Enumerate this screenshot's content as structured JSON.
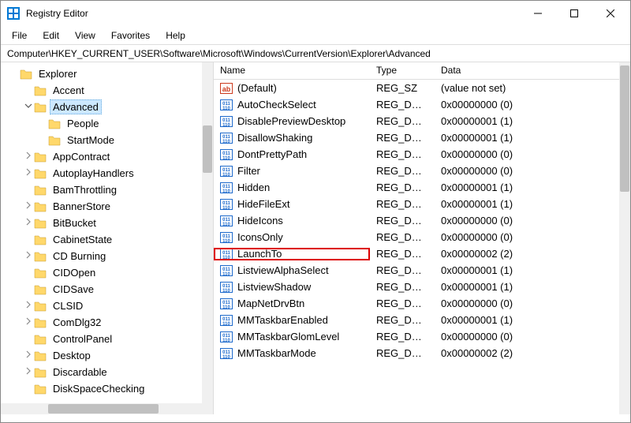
{
  "window": {
    "title": "Registry Editor"
  },
  "menu": {
    "file": "File",
    "edit": "Edit",
    "view": "View",
    "favorites": "Favorites",
    "help": "Help"
  },
  "address": "Computer\\HKEY_CURRENT_USER\\Software\\Microsoft\\Windows\\CurrentVersion\\Explorer\\Advanced",
  "tree": [
    {
      "label": "Explorer",
      "indent": 0,
      "twisty": ""
    },
    {
      "label": "Accent",
      "indent": 1,
      "twisty": ""
    },
    {
      "label": "Advanced",
      "indent": 1,
      "twisty": "v",
      "selected": true
    },
    {
      "label": "People",
      "indent": 2,
      "twisty": ""
    },
    {
      "label": "StartMode",
      "indent": 2,
      "twisty": ""
    },
    {
      "label": "AppContract",
      "indent": 1,
      "twisty": ">"
    },
    {
      "label": "AutoplayHandlers",
      "indent": 1,
      "twisty": ">"
    },
    {
      "label": "BamThrottling",
      "indent": 1,
      "twisty": ""
    },
    {
      "label": "BannerStore",
      "indent": 1,
      "twisty": ">"
    },
    {
      "label": "BitBucket",
      "indent": 1,
      "twisty": ">"
    },
    {
      "label": "CabinetState",
      "indent": 1,
      "twisty": ""
    },
    {
      "label": "CD Burning",
      "indent": 1,
      "twisty": ">"
    },
    {
      "label": "CIDOpen",
      "indent": 1,
      "twisty": ""
    },
    {
      "label": "CIDSave",
      "indent": 1,
      "twisty": ""
    },
    {
      "label": "CLSID",
      "indent": 1,
      "twisty": ">"
    },
    {
      "label": "ComDlg32",
      "indent": 1,
      "twisty": ">"
    },
    {
      "label": "ControlPanel",
      "indent": 1,
      "twisty": ""
    },
    {
      "label": "Desktop",
      "indent": 1,
      "twisty": ">"
    },
    {
      "label": "Discardable",
      "indent": 1,
      "twisty": ">"
    },
    {
      "label": "DiskSpaceChecking",
      "indent": 1,
      "twisty": ""
    }
  ],
  "columns": {
    "name": "Name",
    "type": "Type",
    "data": "Data"
  },
  "values": [
    {
      "name": "(Default)",
      "type": "REG_SZ",
      "data": "(value not set)",
      "icon": "sz"
    },
    {
      "name": "AutoCheckSelect",
      "type": "REG_DW...",
      "data": "0x00000000 (0)",
      "icon": "dw"
    },
    {
      "name": "DisablePreviewDesktop",
      "type": "REG_DW...",
      "data": "0x00000001 (1)",
      "icon": "dw"
    },
    {
      "name": "DisallowShaking",
      "type": "REG_DW...",
      "data": "0x00000001 (1)",
      "icon": "dw"
    },
    {
      "name": "DontPrettyPath",
      "type": "REG_DW...",
      "data": "0x00000000 (0)",
      "icon": "dw"
    },
    {
      "name": "Filter",
      "type": "REG_DW...",
      "data": "0x00000000 (0)",
      "icon": "dw"
    },
    {
      "name": "Hidden",
      "type": "REG_DW...",
      "data": "0x00000001 (1)",
      "icon": "dw"
    },
    {
      "name": "HideFileExt",
      "type": "REG_DW...",
      "data": "0x00000001 (1)",
      "icon": "dw"
    },
    {
      "name": "HideIcons",
      "type": "REG_DW...",
      "data": "0x00000000 (0)",
      "icon": "dw"
    },
    {
      "name": "IconsOnly",
      "type": "REG_DW...",
      "data": "0x00000000 (0)",
      "icon": "dw"
    },
    {
      "name": "LaunchTo",
      "type": "REG_DW...",
      "data": "0x00000002 (2)",
      "icon": "dw",
      "hl": true
    },
    {
      "name": "ListviewAlphaSelect",
      "type": "REG_DW...",
      "data": "0x00000001 (1)",
      "icon": "dw"
    },
    {
      "name": "ListviewShadow",
      "type": "REG_DW...",
      "data": "0x00000001 (1)",
      "icon": "dw"
    },
    {
      "name": "MapNetDrvBtn",
      "type": "REG_DW...",
      "data": "0x00000000 (0)",
      "icon": "dw"
    },
    {
      "name": "MMTaskbarEnabled",
      "type": "REG_DW...",
      "data": "0x00000001 (1)",
      "icon": "dw"
    },
    {
      "name": "MMTaskbarGlomLevel",
      "type": "REG_DW...",
      "data": "0x00000000 (0)",
      "icon": "dw"
    },
    {
      "name": "MMTaskbarMode",
      "type": "REG_DW...",
      "data": "0x00000002 (2)",
      "icon": "dw"
    }
  ]
}
